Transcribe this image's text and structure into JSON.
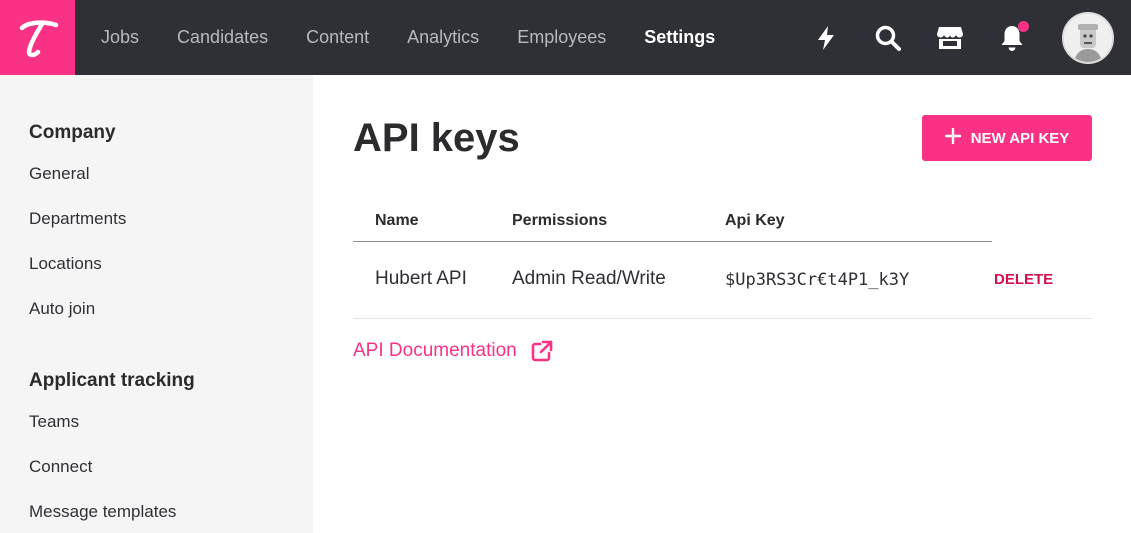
{
  "brand": {
    "logo_letter_icon": "teamtailor-t-logo",
    "accent": "#fa3286",
    "topbar_bg": "#2f3035"
  },
  "nav": {
    "items": [
      {
        "label": "Jobs"
      },
      {
        "label": "Candidates"
      },
      {
        "label": "Content"
      },
      {
        "label": "Analytics"
      },
      {
        "label": "Employees"
      },
      {
        "label": "Settings",
        "active": true
      }
    ],
    "icons": [
      "lightning-icon",
      "search-icon",
      "store-icon",
      "bell-icon"
    ],
    "notification_dot": true
  },
  "sidebar": {
    "sections": [
      {
        "heading": "Company",
        "items": [
          "General",
          "Departments",
          "Locations",
          "Auto join"
        ]
      },
      {
        "heading": "Applicant tracking",
        "items": [
          "Teams",
          "Connect",
          "Message templates"
        ]
      }
    ]
  },
  "main": {
    "title": "API keys",
    "new_button_label": "NEW API KEY",
    "table": {
      "headers": {
        "name": "Name",
        "permissions": "Permissions",
        "api_key": "Api Key"
      },
      "rows": [
        {
          "name": "Hubert API",
          "permissions": "Admin Read/Write",
          "api_key": "$Up3RS3Cr€t4P1_k3Y",
          "action": "DELETE"
        }
      ]
    },
    "doc_link_label": "API Documentation"
  }
}
